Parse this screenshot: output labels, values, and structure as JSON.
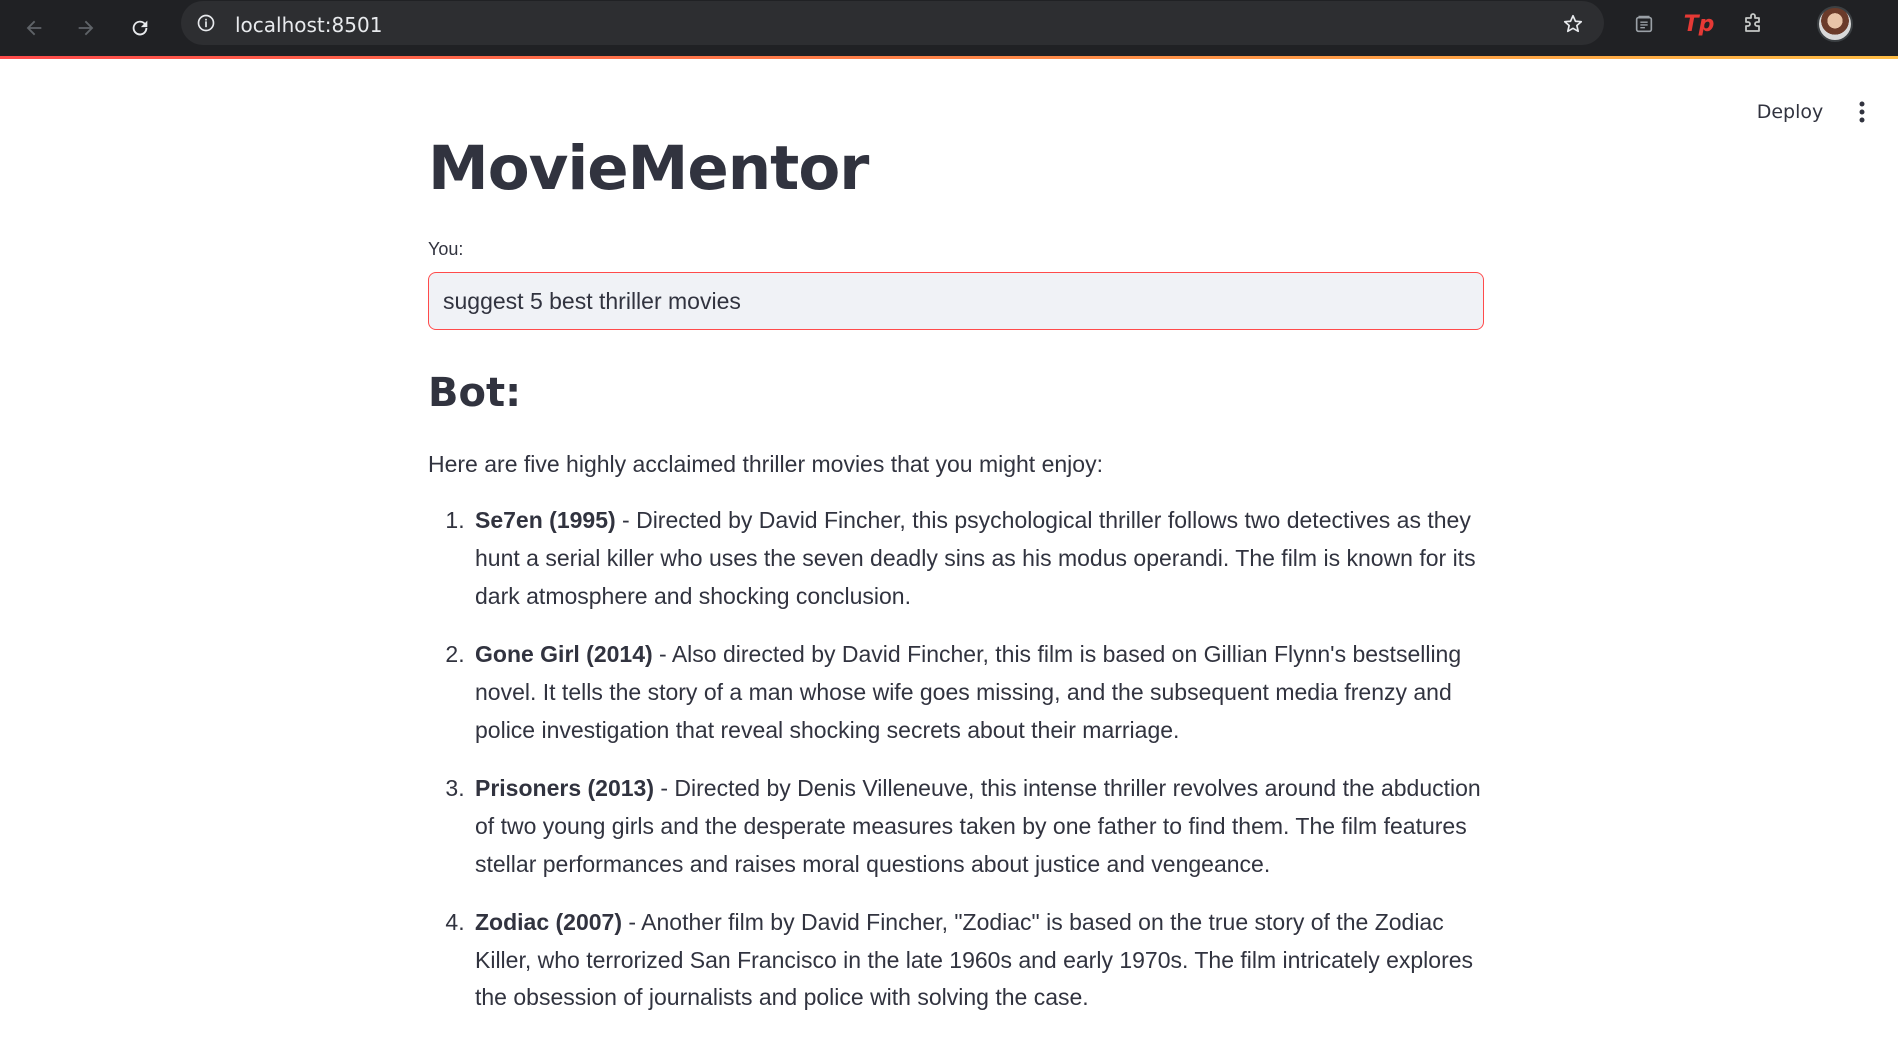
{
  "browser": {
    "url": "localhost:8501"
  },
  "header": {
    "deploy_label": "Deploy"
  },
  "app": {
    "title": "MovieMentor",
    "input_label": "You:",
    "input_value": "suggest 5 best thriller movies",
    "bot_heading": "Bot:",
    "intro": "Here are five highly acclaimed thriller movies that you might enjoy:",
    "movies": [
      {
        "number": "1.",
        "title": "Se7en (1995)",
        "description": " - Directed by David Fincher, this psychological thriller follows two detectives as they hunt a serial killer who uses the seven deadly sins as his modus operandi. The film is known for its dark atmosphere and shocking conclusion."
      },
      {
        "number": "2.",
        "title": "Gone Girl (2014)",
        "description": " - Also directed by David Fincher, this film is based on Gillian Flynn's bestselling novel. It tells the story of a man whose wife goes missing, and the subsequent media frenzy and police investigation that reveal shocking secrets about their marriage."
      },
      {
        "number": "3.",
        "title": "Prisoners (2013)",
        "description": " - Directed by Denis Villeneuve, this intense thriller revolves around the abduction of two young girls and the desperate measures taken by one father to find them. The film features stellar performances and raises moral questions about justice and vengeance."
      },
      {
        "number": "4.",
        "title": "Zodiac (2007)",
        "description": " - Another film by David Fincher, \"Zodiac\" is based on the true story of the Zodiac Killer, who terrorized San Francisco in the late 1960s and early 1970s. The film intricately explores the obsession of journalists and police with solving the case."
      }
    ]
  },
  "colors": {
    "accent": "#ff4b4b",
    "text": "#31333f",
    "chrome_bg": "#202124",
    "input_bg": "#f0f2f6"
  },
  "icons": [
    "back-arrow-icon",
    "forward-arrow-icon",
    "reload-icon",
    "info-icon",
    "bookmark-star-icon",
    "tab-search-icon",
    "tp-extension-icon",
    "extensions-puzzle-icon",
    "profile-avatar",
    "kebab-menu-icon"
  ]
}
